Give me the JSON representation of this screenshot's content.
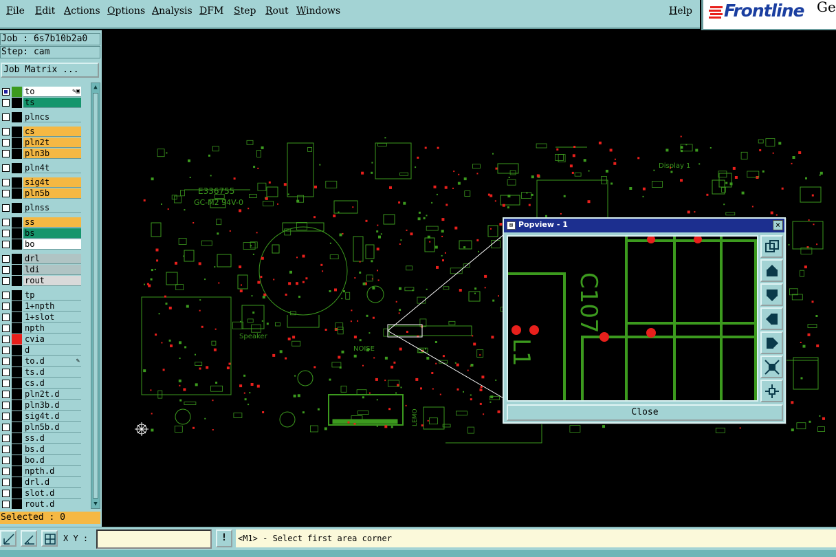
{
  "menubar": {
    "left_items": [
      "File",
      "Edit",
      "Actions",
      "Options",
      "Analysis",
      "DFM",
      "Step",
      "Rout",
      "Windows"
    ],
    "help": "Help"
  },
  "logo": {
    "text": "Frontline",
    "extra": "Ge"
  },
  "job": {
    "job_line": "Job : 6s7b10b2a0",
    "step_line": "Step: cam",
    "matrix_button": "Job Matrix ..."
  },
  "layers": [
    {
      "name": "to",
      "style": "wh",
      "checked": true,
      "color": "#3c9a1e",
      "mark": "✎▣"
    },
    {
      "name": "ts",
      "style": "sm",
      "checked": false,
      "color": "#000000",
      "mark": ""
    },
    {
      "name": "plncs",
      "style": "bd",
      "checked": false,
      "color": "#000000",
      "mark": ""
    },
    {
      "name": "cs",
      "style": "sig",
      "checked": false,
      "color": "#000000",
      "mark": ""
    },
    {
      "name": "pln2t",
      "style": "sig",
      "checked": false,
      "color": "#000000",
      "mark": ""
    },
    {
      "name": "pln3b",
      "style": "sig",
      "checked": false,
      "color": "#000000",
      "mark": ""
    },
    {
      "name": "pln4t",
      "style": "bd",
      "checked": false,
      "color": "#000000",
      "mark": ""
    },
    {
      "name": "sig4t",
      "style": "sig",
      "checked": false,
      "color": "#000000",
      "mark": ""
    },
    {
      "name": "pln5b",
      "style": "sig",
      "checked": false,
      "color": "#000000",
      "mark": ""
    },
    {
      "name": "plnss",
      "style": "bd",
      "checked": false,
      "color": "#000000",
      "mark": ""
    },
    {
      "name": "ss",
      "style": "sig",
      "checked": false,
      "color": "#000000",
      "mark": ""
    },
    {
      "name": "bs",
      "style": "sm",
      "checked": false,
      "color": "#000000",
      "mark": ""
    },
    {
      "name": "bo",
      "style": "wh",
      "checked": false,
      "color": "#000000",
      "mark": ""
    },
    {
      "name": "drl",
      "style": "dr",
      "checked": false,
      "color": "#000000",
      "mark": ""
    },
    {
      "name": "ldi",
      "style": "dr",
      "checked": false,
      "color": "#000000",
      "mark": ""
    },
    {
      "name": "rout",
      "style": "rt",
      "checked": false,
      "color": "#000000",
      "mark": ""
    },
    {
      "name": "tp",
      "style": "bd",
      "checked": false,
      "color": "#000000",
      "mark": ""
    },
    {
      "name": "1+npth",
      "style": "bd",
      "checked": false,
      "color": "#000000",
      "mark": ""
    },
    {
      "name": "1+slot",
      "style": "bd",
      "checked": false,
      "color": "#000000",
      "mark": ""
    },
    {
      "name": "npth",
      "style": "bd",
      "checked": false,
      "color": "#000000",
      "mark": ""
    },
    {
      "name": "cvia",
      "style": "cv",
      "checked": false,
      "color": "#e8201c",
      "mark": ""
    },
    {
      "name": "d",
      "style": "bd",
      "checked": false,
      "color": "#000000",
      "mark": ""
    },
    {
      "name": "to.d",
      "style": "bd",
      "checked": false,
      "color": "#000000",
      "mark": "✎"
    },
    {
      "name": "ts.d",
      "style": "bd",
      "checked": false,
      "color": "#000000",
      "mark": ""
    },
    {
      "name": "cs.d",
      "style": "bd",
      "checked": false,
      "color": "#000000",
      "mark": ""
    },
    {
      "name": "pln2t.d",
      "style": "bd",
      "checked": false,
      "color": "#000000",
      "mark": ""
    },
    {
      "name": "pln3b.d",
      "style": "bd",
      "checked": false,
      "color": "#000000",
      "mark": ""
    },
    {
      "name": "sig4t.d",
      "style": "bd",
      "checked": false,
      "color": "#000000",
      "mark": ""
    },
    {
      "name": "pln5b.d",
      "style": "bd",
      "checked": false,
      "color": "#000000",
      "mark": ""
    },
    {
      "name": "ss.d",
      "style": "bd",
      "checked": false,
      "color": "#000000",
      "mark": ""
    },
    {
      "name": "bs.d",
      "style": "bd",
      "checked": false,
      "color": "#000000",
      "mark": ""
    },
    {
      "name": "bo.d",
      "style": "bd",
      "checked": false,
      "color": "#000000",
      "mark": ""
    },
    {
      "name": "npth.d",
      "style": "bd",
      "checked": false,
      "color": "#000000",
      "mark": ""
    },
    {
      "name": "drl.d",
      "style": "bd",
      "checked": false,
      "color": "#000000",
      "mark": ""
    },
    {
      "name": "slot.d",
      "style": "bd",
      "checked": false,
      "color": "#000000",
      "mark": ""
    },
    {
      "name": "rout.d",
      "style": "bd",
      "checked": false,
      "color": "#000000",
      "mark": ""
    }
  ],
  "selected": "Selected : 0",
  "board": {
    "labels": {
      "ul": "E336755",
      "grade": "GC-M2 94V-0",
      "display": "Display 1",
      "speaker": "Speaker",
      "noise": "NOISE",
      "lemo": "LEMO"
    },
    "colors": {
      "trace": "#3c9a1e",
      "pad": "#e8201c",
      "zoom_lines": "#ffffff"
    }
  },
  "popview": {
    "title": "Popview - 1",
    "close_x": "×",
    "close_button": "Close",
    "labels": {
      "c107": "C107",
      "l1": "L1"
    },
    "tools": [
      "zoom-window-icon",
      "pan-up-icon",
      "pan-down-icon",
      "pan-left-icon",
      "pan-right-icon",
      "zoom-in-icon",
      "zoom-fit-icon"
    ]
  },
  "bottombar": {
    "xy_label": "X Y :",
    "xy_value": "",
    "excl": "!",
    "status": "<M1> - Select first area corner"
  }
}
